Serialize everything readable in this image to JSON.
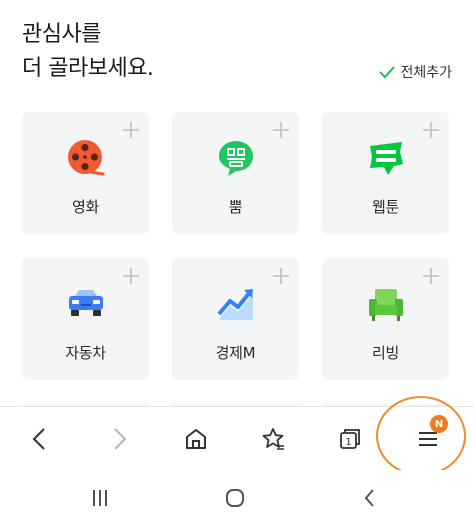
{
  "header": {
    "title_line1": "관심사를",
    "title_line2": "더 골라보세요.",
    "add_all_label": "전체추가"
  },
  "cards": [
    {
      "label": "영화",
      "icon": "movie-reel-icon",
      "color": "#f25a2f"
    },
    {
      "label": "뿜",
      "icon": "ppum-speech-bubble-icon",
      "color": "#1ec75f"
    },
    {
      "label": "웹툰",
      "icon": "webtoon-badge-icon",
      "color": "#00c73c"
    },
    {
      "label": "자동차",
      "icon": "car-icon",
      "color": "#3d7cf5"
    },
    {
      "label": "경제M",
      "icon": "rising-chart-icon",
      "color": "#2e86f5"
    },
    {
      "label": "리빙",
      "icon": "armchair-icon",
      "color": "#5cc63f"
    }
  ],
  "toolbar": {
    "items": [
      "back-icon",
      "forward-icon",
      "home-icon",
      "bookmark-star-icon",
      "tabs-icon",
      "menu-icon"
    ],
    "tabs_count": "1",
    "menu_badge": "N",
    "badge_color": "#f07b1e"
  },
  "system_nav": [
    "recent-apps-icon",
    "home-circle-icon",
    "back-chevron-icon"
  ]
}
